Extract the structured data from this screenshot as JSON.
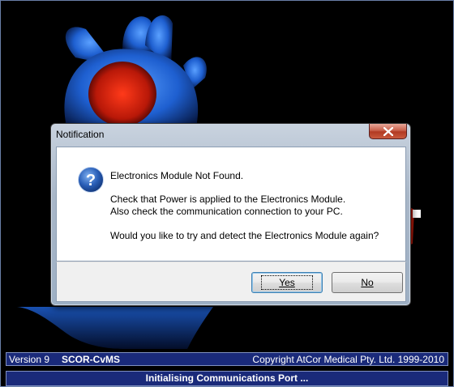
{
  "dialog": {
    "title": "Notification",
    "close_icon": "close-icon",
    "question_icon": "question-icon",
    "message_title": "Electronics Module Not Found.",
    "message_line1": "Check that Power is applied to the Electronics Module.",
    "message_line2": "Also check the communication connection to your PC.",
    "message_line3": "Would you like to try and detect the Electronics Module again?",
    "yes_label": "Yes",
    "no_label": "No"
  },
  "status": {
    "version": "Version 9",
    "product": "SCOR-CvMS",
    "copyright": "Copyright AtCor Medical Pty. Ltd. 1999-2010",
    "message": "Initialising Communications Port ..."
  },
  "colors": {
    "status_bar": "#1a2a7a",
    "dialog_frame": "#a9b7c8",
    "heart_blue": "#1e5fd0",
    "heart_red": "#d02010"
  }
}
